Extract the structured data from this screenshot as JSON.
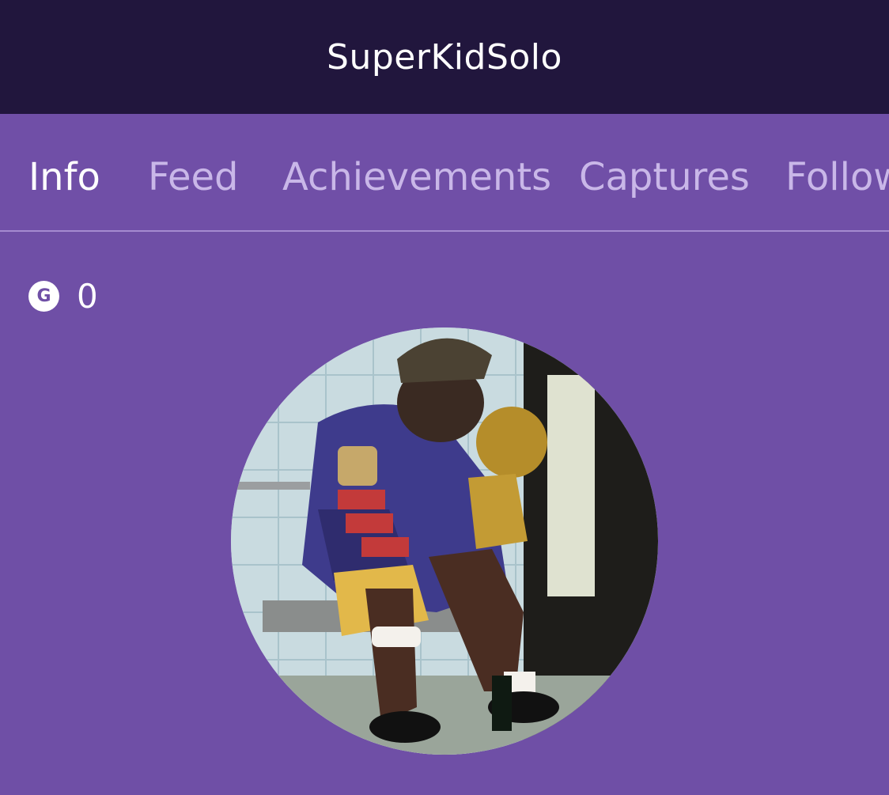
{
  "header": {
    "title": "SuperKidSolo"
  },
  "tabs": [
    {
      "label": "Info",
      "active": true
    },
    {
      "label": "Feed",
      "active": false
    },
    {
      "label": "Achievements",
      "active": false
    },
    {
      "label": "Captures",
      "active": false
    },
    {
      "label": "Follow",
      "active": false
    }
  ],
  "profile": {
    "gamerscore_icon": "G",
    "gamerscore": "0",
    "avatar_icon": "profile-photo"
  },
  "colors": {
    "header_bg": "#21163d",
    "page_bg": "#6f4fa6",
    "tab_active": "#ffffff",
    "tab_inactive": "#c9b7e8"
  }
}
